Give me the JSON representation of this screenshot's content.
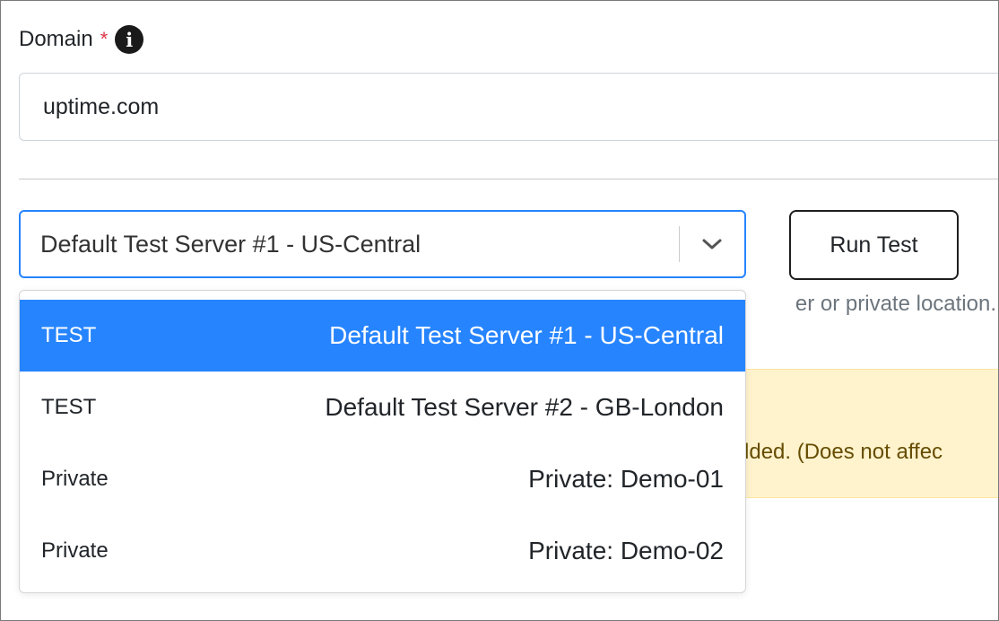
{
  "form": {
    "domain_label": "Domain",
    "required_marker": "*",
    "info_icon": "info-circle-icon",
    "domain_value": "uptime.com"
  },
  "location_select": {
    "selected_value": "Default Test Server #1 - US-Central",
    "arrow_icon": "chevron-down-icon",
    "options": [
      {
        "tag": "TEST",
        "name": "Default Test Server #1 - US-Central",
        "selected": true
      },
      {
        "tag": "TEST",
        "name": "Default Test Server #2 - GB-London",
        "selected": false
      },
      {
        "tag": "Private",
        "name": "Private: Demo-01",
        "selected": false
      },
      {
        "tag": "Private",
        "name": "Private: Demo-02",
        "selected": false
      }
    ]
  },
  "run_button": {
    "label": "Run Test"
  },
  "help_text": "er or private location.",
  "alert": {
    "text": "dded. (Does not affec"
  },
  "colors": {
    "accent": "#2684ff",
    "required": "#dc3545",
    "alert_bg": "#fff3cd",
    "alert_text": "#664d03"
  }
}
